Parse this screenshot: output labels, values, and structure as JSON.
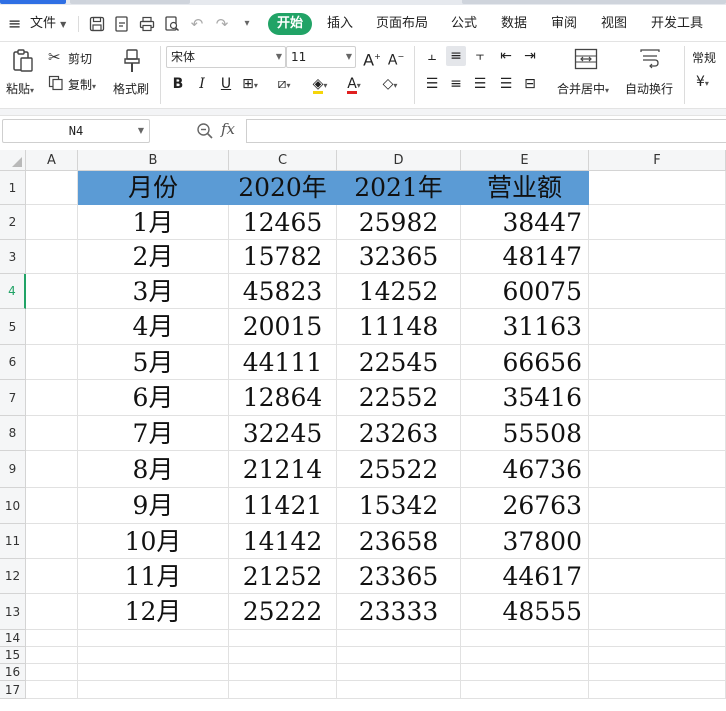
{
  "menu": {
    "file_label": "文件",
    "tabs": [
      "开始",
      "插入",
      "页面布局",
      "公式",
      "数据",
      "审阅",
      "视图",
      "开发工具"
    ],
    "active_tab": "开始"
  },
  "ribbon": {
    "paste": "粘贴",
    "cut": "剪切",
    "copy": "复制",
    "format_painter": "格式刷",
    "font_name": "宋体",
    "font_size": "11",
    "merge_center": "合并居中",
    "wrap_text": "自动换行",
    "number_format": "常规",
    "currency_symbol": "¥"
  },
  "formula_bar": {
    "name_box": "N4",
    "fx_label": "fx",
    "formula": ""
  },
  "colors": {
    "accent": "#21a366",
    "header_fill": "#5b9bd5"
  },
  "sheet": {
    "columns": [
      "A",
      "B",
      "C",
      "D",
      "E",
      "F"
    ],
    "row_numbers": [
      "1",
      "2",
      "3",
      "4",
      "5",
      "6",
      "7",
      "8",
      "9",
      "10",
      "11",
      "12",
      "13",
      "14",
      "15",
      "16",
      "17"
    ],
    "active_row": "4",
    "header": [
      "月份",
      "2020年",
      "2021年",
      "营业额"
    ],
    "rows": [
      [
        "1月",
        "12465",
        "25982",
        "38447"
      ],
      [
        "2月",
        "15782",
        "32365",
        "48147"
      ],
      [
        "3月",
        "45823",
        "14252",
        "60075"
      ],
      [
        "4月",
        "20015",
        "11148",
        "31163"
      ],
      [
        "5月",
        "44111",
        "22545",
        "66656"
      ],
      [
        "6月",
        "12864",
        "22552",
        "35416"
      ],
      [
        "7月",
        "32245",
        "23263",
        "55508"
      ],
      [
        "8月",
        "21214",
        "25522",
        "46736"
      ],
      [
        "9月",
        "11421",
        "15342",
        "26763"
      ],
      [
        "10月",
        "14142",
        "23658",
        "37800"
      ],
      [
        "11月",
        "21252",
        "23365",
        "44617"
      ],
      [
        "12月",
        "25222",
        "23333",
        "48555"
      ]
    ]
  }
}
